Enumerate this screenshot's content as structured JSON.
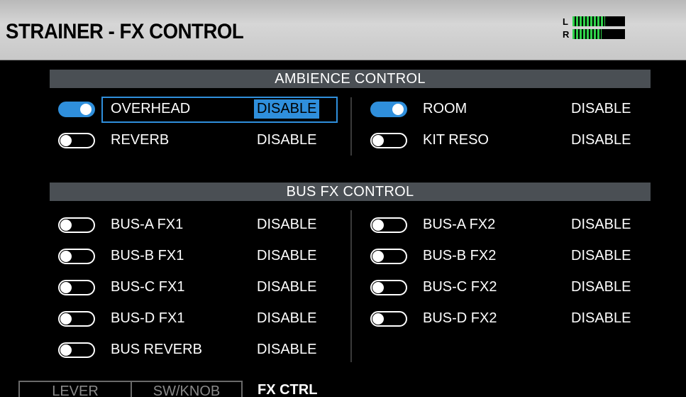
{
  "header": {
    "title": "STRAINER - FX CONTROL",
    "meter": {
      "left_label": "L",
      "right_label": "R",
      "left_level": 0.62,
      "right_level": 0.55,
      "color": "#2fd14a"
    }
  },
  "ambience": {
    "title": "AMBIENCE CONTROL",
    "left": [
      {
        "label": "OVERHEAD",
        "status": "DISABLE",
        "on": true,
        "focused": true
      },
      {
        "label": "REVERB",
        "status": "DISABLE",
        "on": false,
        "focused": false
      }
    ],
    "right": [
      {
        "label": "ROOM",
        "status": "DISABLE",
        "on": true,
        "focused": false
      },
      {
        "label": "KIT RESO",
        "status": "DISABLE",
        "on": false,
        "focused": false
      }
    ]
  },
  "bus_fx": {
    "title": "BUS FX CONTROL",
    "left": [
      {
        "label": "BUS-A FX1",
        "status": "DISABLE",
        "on": false
      },
      {
        "label": "BUS-B FX1",
        "status": "DISABLE",
        "on": false
      },
      {
        "label": "BUS-C FX1",
        "status": "DISABLE",
        "on": false
      },
      {
        "label": "BUS-D FX1",
        "status": "DISABLE",
        "on": false
      },
      {
        "label": "BUS REVERB",
        "status": "DISABLE",
        "on": false
      }
    ],
    "right": [
      {
        "label": "BUS-A FX2",
        "status": "DISABLE",
        "on": false
      },
      {
        "label": "BUS-B FX2",
        "status": "DISABLE",
        "on": false
      },
      {
        "label": "BUS-C FX2",
        "status": "DISABLE",
        "on": false
      },
      {
        "label": "BUS-D FX2",
        "status": "DISABLE",
        "on": false
      }
    ]
  },
  "tabs": [
    {
      "label": "LEVER",
      "active": false
    },
    {
      "label": "SW/KNOB",
      "active": false
    },
    {
      "label": "FX CTRL",
      "active": true
    }
  ],
  "colors": {
    "accent": "#2f8fdc",
    "header_band": "#4a4f54",
    "title_bar": "#c8c8c8"
  }
}
